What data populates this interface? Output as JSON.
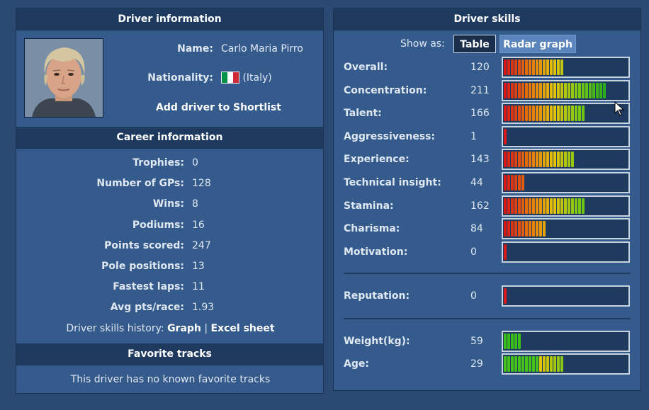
{
  "driver_info": {
    "header": "Driver information",
    "name_label": "Name:",
    "name_value": "Carlo Maria Pirro",
    "nationality_label": "Nationality:",
    "nationality_value": "(Italy)",
    "flag_colors": [
      "#009246",
      "#ffffff",
      "#ce2b37"
    ],
    "add_shortlist": "Add driver to Shortlist"
  },
  "career": {
    "header": "Career information",
    "rows": [
      {
        "label": "Trophies:",
        "value": "0"
      },
      {
        "label": "Number of GPs:",
        "value": "128"
      },
      {
        "label": "Wins:",
        "value": "8"
      },
      {
        "label": "Podiums:",
        "value": "16"
      },
      {
        "label": "Points scored:",
        "value": "247"
      },
      {
        "label": "Pole positions:",
        "value": "13"
      },
      {
        "label": "Fastest laps:",
        "value": "11"
      },
      {
        "label": "Avg pts/race:",
        "value": "1.93"
      }
    ],
    "history_label": "Driver skills history:",
    "history_graph": "Graph",
    "history_sep": "|",
    "history_excel": "Excel sheet"
  },
  "favorite_tracks": {
    "header": "Favorite tracks",
    "text": "This driver has no known favorite tracks"
  },
  "skills": {
    "header": "Driver skills",
    "show_as": "Show as:",
    "btn_table": "Table",
    "btn_radar": "Radar graph",
    "rows": [
      {
        "label": "Overall:",
        "value": "120",
        "segments": 17
      },
      {
        "label": "Concentration:",
        "value": "211",
        "segments": 29
      },
      {
        "label": "Talent:",
        "value": "166",
        "segments": 23
      },
      {
        "label": "Aggressiveness:",
        "value": "1",
        "segments": 1
      },
      {
        "label": "Experience:",
        "value": "143",
        "segments": 20
      },
      {
        "label": "Technical insight:",
        "value": "44",
        "segments": 6
      },
      {
        "label": "Stamina:",
        "value": "162",
        "segments": 23
      },
      {
        "label": "Charisma:",
        "value": "84",
        "segments": 12
      },
      {
        "label": "Motivation:",
        "value": "0",
        "segments": 1
      }
    ],
    "reputation": {
      "label": "Reputation:",
      "value": "0",
      "segments": 1
    },
    "weight": {
      "label": "Weight(kg):",
      "value": "59",
      "segments": 5
    },
    "age": {
      "label": "Age:",
      "value": "29",
      "segments": 17
    }
  }
}
